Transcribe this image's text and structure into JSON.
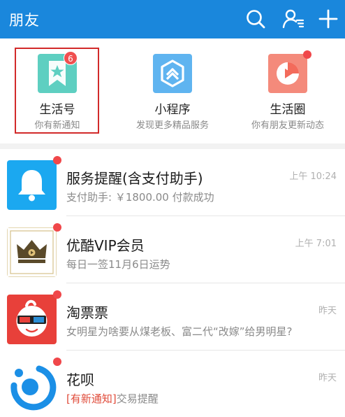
{
  "header": {
    "title": "朋友",
    "icons": [
      "search-icon",
      "contacts-icon",
      "add-icon"
    ]
  },
  "services": [
    {
      "name": "生活号",
      "desc": "你有新通知",
      "icon": "bookmark-star-icon",
      "badge": "6",
      "color": "#5ecfc1"
    },
    {
      "name": "小程序",
      "desc": "发现更多精品服务",
      "icon": "mini-program-icon",
      "color": "#5fb4f0"
    },
    {
      "name": "生活圈",
      "desc": "你有朋友更新动态",
      "icon": "life-circle-icon",
      "color": "#f36b5b"
    }
  ],
  "messages": [
    {
      "name": "服务提醒(含支付助手)",
      "preview": "支付助手: ￥1800.00 付款成功",
      "time": "上午 10:24",
      "icon": "bell-icon"
    },
    {
      "name": "优酷VIP会员",
      "preview": "每日一签11月6日运势",
      "time": "上午 7:01",
      "icon": "crown-icon"
    },
    {
      "name": "淘票票",
      "preview": "女明星为啥要从煤老板、富二代“改嫁”给男明星?",
      "time": "昨天",
      "icon": "3d-glasses-icon"
    },
    {
      "name": "花呗",
      "preview_tag": "[有新通知]",
      "preview": "交易提醒",
      "time": "昨天",
      "icon": "huabei-icon"
    }
  ],
  "colors": {
    "header": "#1a87dc",
    "badge": "#f05050",
    "highlight": "#d22a2a"
  }
}
